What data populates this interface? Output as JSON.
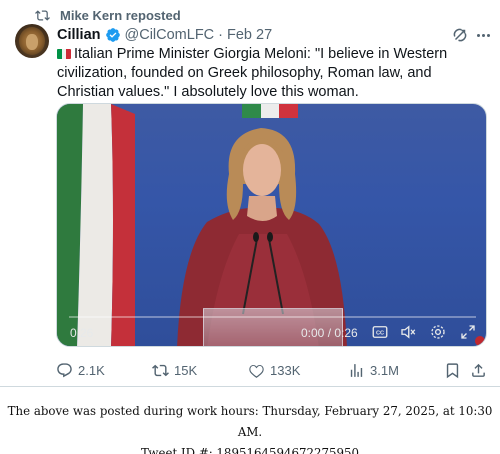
{
  "repost": {
    "label": "Mike Kern reposted",
    "icon": "repost-icon"
  },
  "author": {
    "name": "Cillian",
    "handle": "@CilComLFC",
    "separator": "·",
    "date": "Feb 27",
    "verified_color": "#1d9bf0",
    "avatar": "lion-avatar"
  },
  "tweet": {
    "flag_emoji": "italian-flag",
    "text": "Italian Prime Minister Giorgia Meloni: \"I believe in Western civilization, founded on Greek philosophy, Roman law, and Christian values.\" I absolutely love this woman."
  },
  "video": {
    "current_time": "0:26",
    "time_display": "0:00 / 0:26",
    "progress": 0.0,
    "controls": [
      "cc-icon",
      "mute-icon",
      "settings-icon",
      "fullscreen-icon"
    ]
  },
  "actions": {
    "replies": "2.1K",
    "reposts": "15K",
    "likes": "133K",
    "views": "3.1M"
  },
  "caption": {
    "line1": "The above was posted during work hours: Thursday, February 27, 2025, at 10:30 AM.",
    "line2": "Tweet ID #: 1895164594672275950"
  },
  "colors": {
    "muted_text": "#536471",
    "flag_green": "#009246",
    "flag_white": "#f1f2f1",
    "flag_red": "#ce2b37",
    "video_bg": "#3556a8"
  }
}
